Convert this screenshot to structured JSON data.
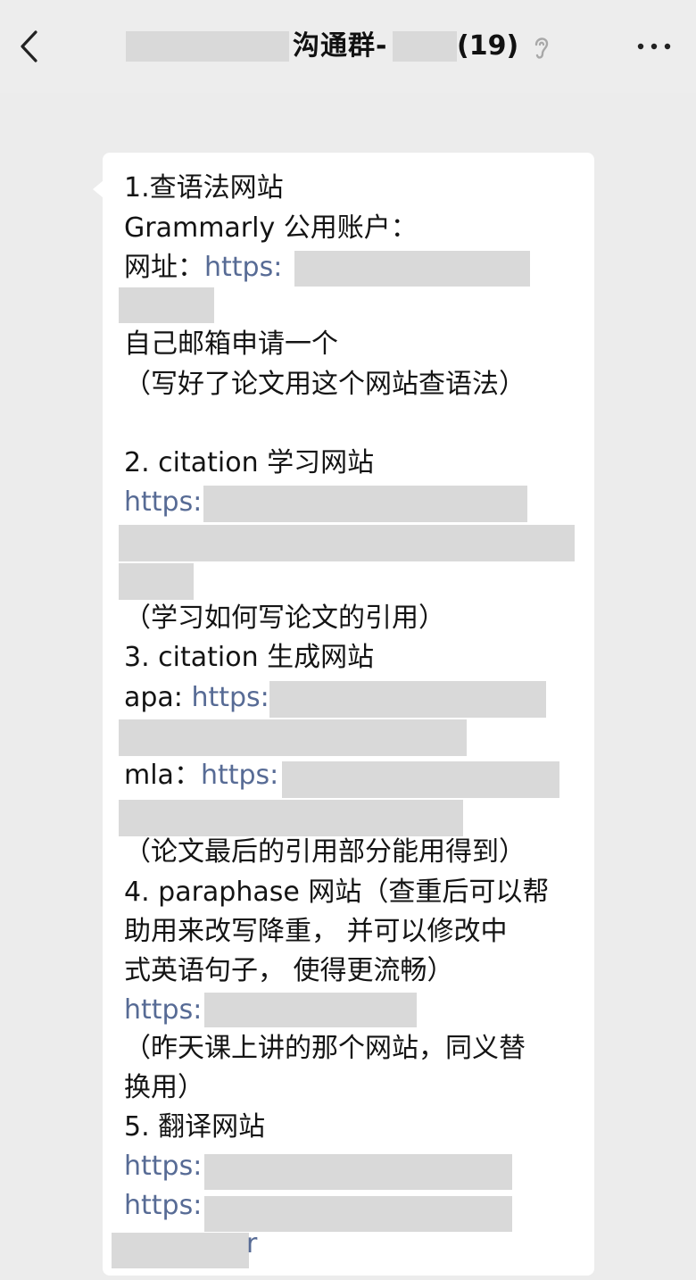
{
  "header": {
    "title": "沟通群-",
    "member_count": "(19)"
  },
  "message": {
    "lines": [
      "1.查语法网站",
      "Grammarly 公用账户：",
      "网址：",
      "https:",
      "自己邮箱申请一个",
      "（写好了论文用这个网站查语法）",
      "2. citation 学习网站",
      "https:",
      "（学习如何写论文的引用）",
      "3. citation 生成网站",
      "apa: ",
      "https:",
      "mla：",
      "https:",
      "（论文最后的引用部分能用得到）",
      "4. paraphase 网站（查重后可以帮",
      "助用来改写降重，  并可以修改中",
      "式英语句子，  使得更流畅）",
      "https:",
      "（昨天课上讲的那个网站，同义替",
      "换用）",
      "5. 翻译网站",
      "https:",
      "https:",
      "r"
    ]
  },
  "colors": {
    "link": "#576b95",
    "redaction": "#d9d9d9",
    "background": "#ececec",
    "bubble": "#ffffff"
  }
}
